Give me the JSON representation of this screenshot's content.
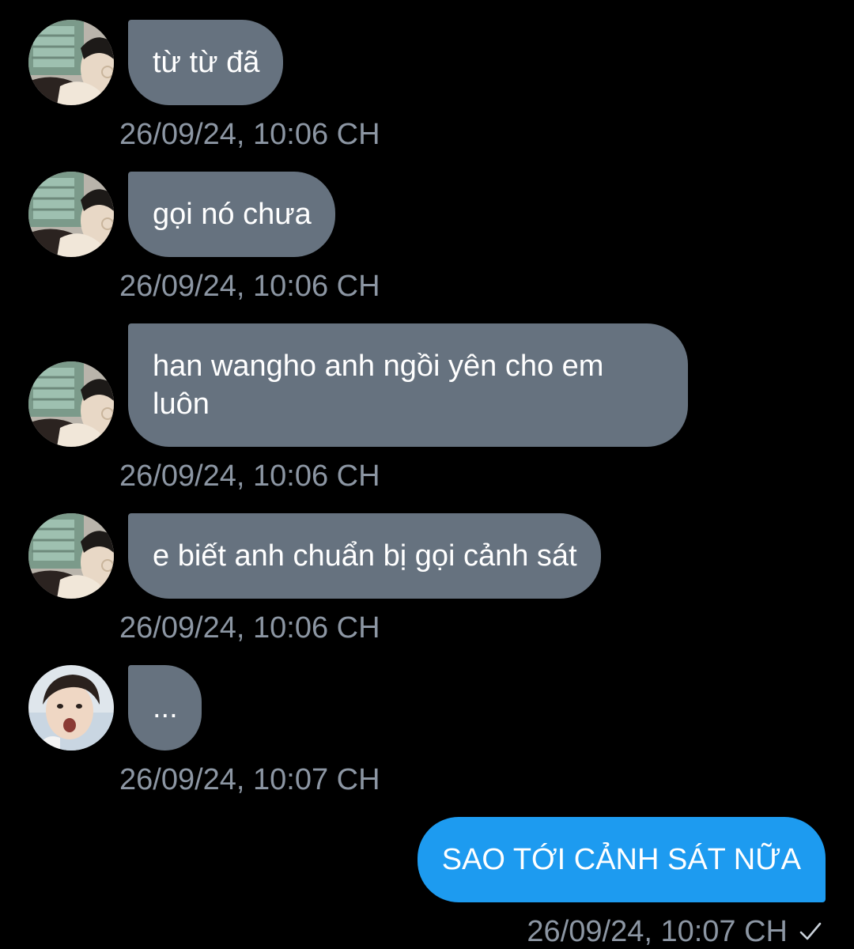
{
  "messages": [
    {
      "text": "từ từ đã",
      "time": "26/09/24, 10:06 CH",
      "avatar": "avatar-photo-a"
    },
    {
      "text": "gọi nó chưa",
      "time": "26/09/24, 10:06 CH",
      "avatar": "avatar-photo-a"
    },
    {
      "text": "han wangho anh ngồi yên cho em\nluôn",
      "time": "26/09/24, 10:06 CH",
      "avatar": "avatar-photo-a"
    },
    {
      "text": "e biết anh chuẩn bị gọi cảnh sát",
      "time": "26/09/24, 10:06 CH",
      "avatar": "avatar-photo-a"
    },
    {
      "text": "...",
      "time": "26/09/24, 10:07 CH",
      "avatar": "avatar-photo-b"
    }
  ],
  "sent": {
    "text": "SAO TỚI CẢNH SÁT NỮA",
    "time": "26/09/24, 10:07 CH",
    "status_icon": "check-icon"
  },
  "colors": {
    "background": "#000000",
    "received_bubble": "#66727f",
    "sent_bubble": "#1d9bf0",
    "timestamp": "#8c96a3"
  }
}
